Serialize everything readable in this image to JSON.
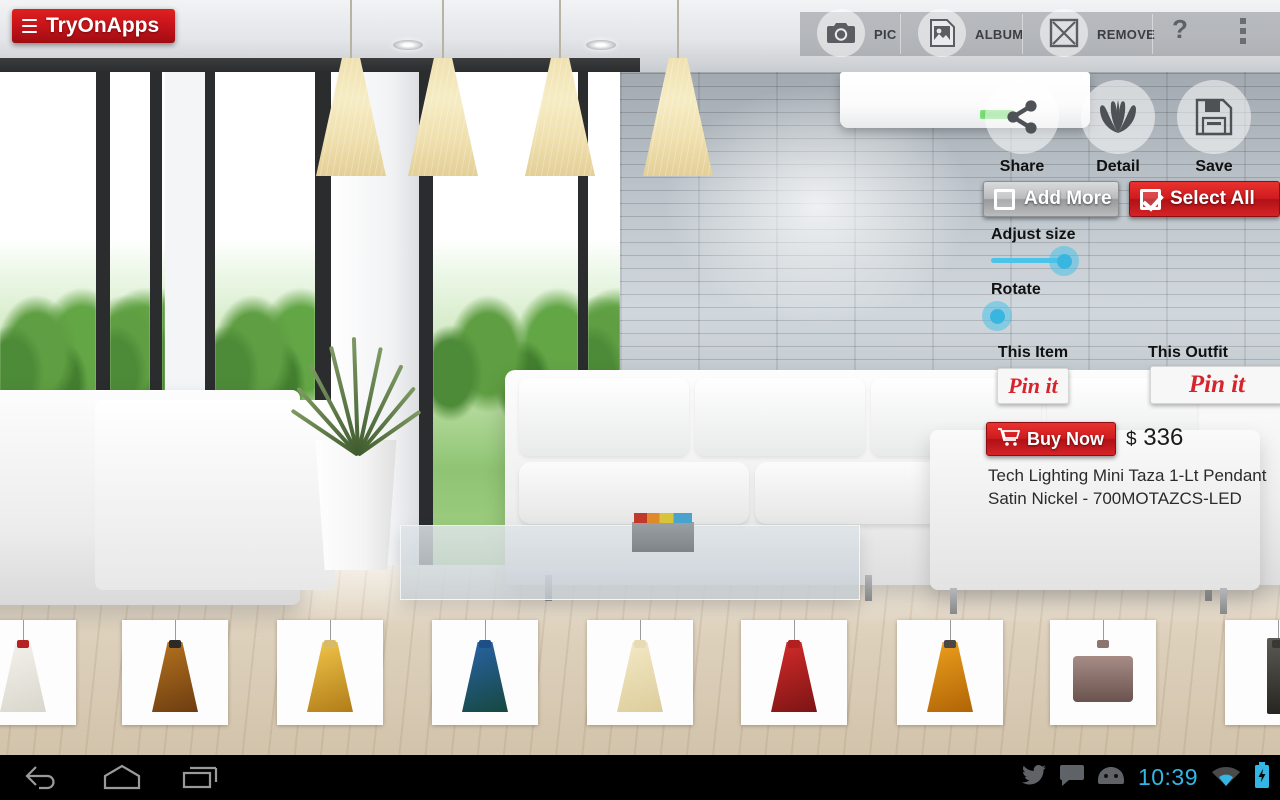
{
  "app": {
    "name": "TryOnApps",
    "menu_icon": "hamburger-icon"
  },
  "topbar": {
    "items": [
      {
        "id": "pic",
        "label": "PIC",
        "icon": "camera-icon"
      },
      {
        "id": "album",
        "label": "ALBUM",
        "icon": "album-photo-icon"
      },
      {
        "id": "remove",
        "label": "REMOVE",
        "icon": "close-x-icon"
      }
    ],
    "help_label": "?",
    "overflow_icon": "more-vertical-icon"
  },
  "panel": {
    "actions": [
      {
        "id": "share",
        "label": "Share",
        "icon": "share-icon"
      },
      {
        "id": "detail",
        "label": "Detail",
        "icon": "shell-fan-icon"
      },
      {
        "id": "save",
        "label": "Save",
        "icon": "floppy-disk-icon"
      }
    ],
    "add_more": {
      "label": "Add More",
      "checked": false
    },
    "select_all": {
      "label": "Select All",
      "checked": true
    },
    "sliders": [
      {
        "id": "adjust-size",
        "label": "Adjust size",
        "value": 88
      },
      {
        "id": "rotate",
        "label": "Rotate",
        "value": 0
      }
    ],
    "pins": [
      {
        "id": "this-item",
        "caption": "This Item",
        "button": "Pin it"
      },
      {
        "id": "this-outfit",
        "caption": "This Outfit",
        "button": "Pin it"
      }
    ],
    "buy": {
      "label": "Buy Now",
      "icon": "shopping-cart-icon"
    },
    "price": {
      "currency": "$",
      "amount": "336"
    },
    "product_name": "Tech Lighting Mini Taza 1-Lt Pendant Satin Nickel - 700MOTAZCS-LED"
  },
  "filmstrip": {
    "items": [
      {
        "id": "thumb-1",
        "name": "clear-spun-pendant",
        "shape": "cone",
        "color1": "#f4f2ec",
        "color2": "#d9d6cc",
        "cap": "#b52222"
      },
      {
        "id": "thumb-2",
        "name": "amber-wood-pendant",
        "shape": "cone",
        "color1": "#b5731f",
        "color2": "#6d3d10",
        "cap": "#2c2a26"
      },
      {
        "id": "thumb-3",
        "name": "gold-swirl-pendant",
        "shape": "cone",
        "color1": "#f2c64a",
        "color2": "#b07c18",
        "cap": "#d8bb6a"
      },
      {
        "id": "thumb-4",
        "name": "blue-green-swirl-pendant",
        "shape": "cone",
        "color1": "#2a63a8",
        "color2": "#16483f",
        "cap": "#1d4f86"
      },
      {
        "id": "thumb-5",
        "name": "cream-taza-pendant",
        "shape": "cone",
        "color1": "#f3e9c6",
        "color2": "#ddcd9b",
        "cap": "#e6dbb4"
      },
      {
        "id": "thumb-6",
        "name": "red-swirl-pendant",
        "shape": "cone",
        "color1": "#d62b2b",
        "color2": "#7c1414",
        "cap": "#b02020"
      },
      {
        "id": "thumb-7",
        "name": "amber-cone-pendant",
        "shape": "cone",
        "color1": "#eda01d",
        "color2": "#b06406",
        "cap": "#4a4642"
      },
      {
        "id": "thumb-8",
        "name": "brown-drum-pendant",
        "shape": "drum",
        "color1": "#a78c86",
        "color2": "#6a534e",
        "cap": "#8d756f"
      },
      {
        "id": "thumb-9",
        "name": "dark-cylinder-pendant",
        "shape": "cyl",
        "color1": "#5c5a54",
        "color2": "#26251f",
        "cap": "#3a3832"
      }
    ]
  },
  "statusbar": {
    "nav": [
      {
        "id": "back",
        "icon": "back-arrow-icon"
      },
      {
        "id": "home",
        "icon": "home-icon"
      },
      {
        "id": "recent",
        "icon": "recent-apps-icon"
      }
    ],
    "notifications": [
      {
        "id": "twitter",
        "icon": "twitter-bird-icon"
      },
      {
        "id": "message",
        "icon": "chat-bubble-icon"
      },
      {
        "id": "android",
        "icon": "android-robot-icon"
      }
    ],
    "time": "10:39",
    "wifi_icon": "wifi-icon",
    "battery_icon": "battery-charging-icon",
    "accent_color": "#33b5e5"
  }
}
